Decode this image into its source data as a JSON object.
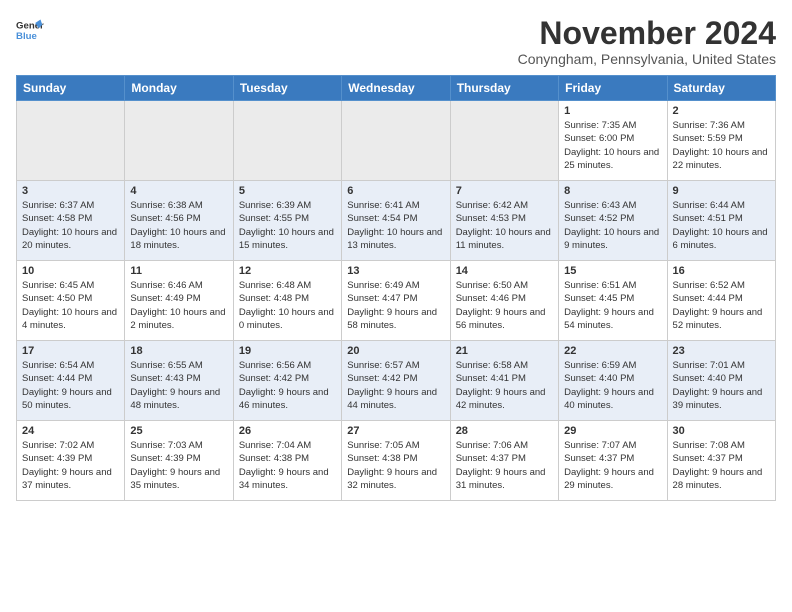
{
  "header": {
    "logo_line1": "General",
    "logo_line2": "Blue",
    "month": "November 2024",
    "location": "Conyngham, Pennsylvania, United States"
  },
  "weekdays": [
    "Sunday",
    "Monday",
    "Tuesday",
    "Wednesday",
    "Thursday",
    "Friday",
    "Saturday"
  ],
  "weeks": [
    [
      {
        "day": "",
        "empty": true
      },
      {
        "day": "",
        "empty": true
      },
      {
        "day": "",
        "empty": true
      },
      {
        "day": "",
        "empty": true
      },
      {
        "day": "",
        "empty": true
      },
      {
        "day": "1",
        "sunrise": "Sunrise: 7:35 AM",
        "sunset": "Sunset: 6:00 PM",
        "daylight": "Daylight: 10 hours and 25 minutes."
      },
      {
        "day": "2",
        "sunrise": "Sunrise: 7:36 AM",
        "sunset": "Sunset: 5:59 PM",
        "daylight": "Daylight: 10 hours and 22 minutes."
      }
    ],
    [
      {
        "day": "3",
        "sunrise": "Sunrise: 6:37 AM",
        "sunset": "Sunset: 4:58 PM",
        "daylight": "Daylight: 10 hours and 20 minutes."
      },
      {
        "day": "4",
        "sunrise": "Sunrise: 6:38 AM",
        "sunset": "Sunset: 4:56 PM",
        "daylight": "Daylight: 10 hours and 18 minutes."
      },
      {
        "day": "5",
        "sunrise": "Sunrise: 6:39 AM",
        "sunset": "Sunset: 4:55 PM",
        "daylight": "Daylight: 10 hours and 15 minutes."
      },
      {
        "day": "6",
        "sunrise": "Sunrise: 6:41 AM",
        "sunset": "Sunset: 4:54 PM",
        "daylight": "Daylight: 10 hours and 13 minutes."
      },
      {
        "day": "7",
        "sunrise": "Sunrise: 6:42 AM",
        "sunset": "Sunset: 4:53 PM",
        "daylight": "Daylight: 10 hours and 11 minutes."
      },
      {
        "day": "8",
        "sunrise": "Sunrise: 6:43 AM",
        "sunset": "Sunset: 4:52 PM",
        "daylight": "Daylight: 10 hours and 9 minutes."
      },
      {
        "day": "9",
        "sunrise": "Sunrise: 6:44 AM",
        "sunset": "Sunset: 4:51 PM",
        "daylight": "Daylight: 10 hours and 6 minutes."
      }
    ],
    [
      {
        "day": "10",
        "sunrise": "Sunrise: 6:45 AM",
        "sunset": "Sunset: 4:50 PM",
        "daylight": "Daylight: 10 hours and 4 minutes."
      },
      {
        "day": "11",
        "sunrise": "Sunrise: 6:46 AM",
        "sunset": "Sunset: 4:49 PM",
        "daylight": "Daylight: 10 hours and 2 minutes."
      },
      {
        "day": "12",
        "sunrise": "Sunrise: 6:48 AM",
        "sunset": "Sunset: 4:48 PM",
        "daylight": "Daylight: 10 hours and 0 minutes."
      },
      {
        "day": "13",
        "sunrise": "Sunrise: 6:49 AM",
        "sunset": "Sunset: 4:47 PM",
        "daylight": "Daylight: 9 hours and 58 minutes."
      },
      {
        "day": "14",
        "sunrise": "Sunrise: 6:50 AM",
        "sunset": "Sunset: 4:46 PM",
        "daylight": "Daylight: 9 hours and 56 minutes."
      },
      {
        "day": "15",
        "sunrise": "Sunrise: 6:51 AM",
        "sunset": "Sunset: 4:45 PM",
        "daylight": "Daylight: 9 hours and 54 minutes."
      },
      {
        "day": "16",
        "sunrise": "Sunrise: 6:52 AM",
        "sunset": "Sunset: 4:44 PM",
        "daylight": "Daylight: 9 hours and 52 minutes."
      }
    ],
    [
      {
        "day": "17",
        "sunrise": "Sunrise: 6:54 AM",
        "sunset": "Sunset: 4:44 PM",
        "daylight": "Daylight: 9 hours and 50 minutes."
      },
      {
        "day": "18",
        "sunrise": "Sunrise: 6:55 AM",
        "sunset": "Sunset: 4:43 PM",
        "daylight": "Daylight: 9 hours and 48 minutes."
      },
      {
        "day": "19",
        "sunrise": "Sunrise: 6:56 AM",
        "sunset": "Sunset: 4:42 PM",
        "daylight": "Daylight: 9 hours and 46 minutes."
      },
      {
        "day": "20",
        "sunrise": "Sunrise: 6:57 AM",
        "sunset": "Sunset: 4:42 PM",
        "daylight": "Daylight: 9 hours and 44 minutes."
      },
      {
        "day": "21",
        "sunrise": "Sunrise: 6:58 AM",
        "sunset": "Sunset: 4:41 PM",
        "daylight": "Daylight: 9 hours and 42 minutes."
      },
      {
        "day": "22",
        "sunrise": "Sunrise: 6:59 AM",
        "sunset": "Sunset: 4:40 PM",
        "daylight": "Daylight: 9 hours and 40 minutes."
      },
      {
        "day": "23",
        "sunrise": "Sunrise: 7:01 AM",
        "sunset": "Sunset: 4:40 PM",
        "daylight": "Daylight: 9 hours and 39 minutes."
      }
    ],
    [
      {
        "day": "24",
        "sunrise": "Sunrise: 7:02 AM",
        "sunset": "Sunset: 4:39 PM",
        "daylight": "Daylight: 9 hours and 37 minutes."
      },
      {
        "day": "25",
        "sunrise": "Sunrise: 7:03 AM",
        "sunset": "Sunset: 4:39 PM",
        "daylight": "Daylight: 9 hours and 35 minutes."
      },
      {
        "day": "26",
        "sunrise": "Sunrise: 7:04 AM",
        "sunset": "Sunset: 4:38 PM",
        "daylight": "Daylight: 9 hours and 34 minutes."
      },
      {
        "day": "27",
        "sunrise": "Sunrise: 7:05 AM",
        "sunset": "Sunset: 4:38 PM",
        "daylight": "Daylight: 9 hours and 32 minutes."
      },
      {
        "day": "28",
        "sunrise": "Sunrise: 7:06 AM",
        "sunset": "Sunset: 4:37 PM",
        "daylight": "Daylight: 9 hours and 31 minutes."
      },
      {
        "day": "29",
        "sunrise": "Sunrise: 7:07 AM",
        "sunset": "Sunset: 4:37 PM",
        "daylight": "Daylight: 9 hours and 29 minutes."
      },
      {
        "day": "30",
        "sunrise": "Sunrise: 7:08 AM",
        "sunset": "Sunset: 4:37 PM",
        "daylight": "Daylight: 9 hours and 28 minutes."
      }
    ]
  ]
}
